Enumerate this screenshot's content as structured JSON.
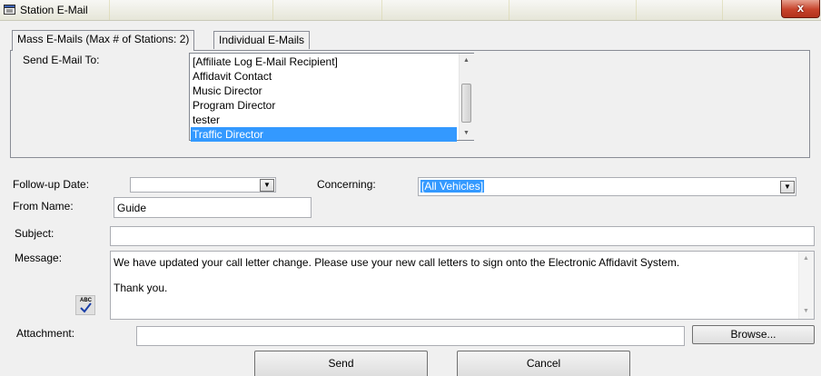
{
  "window": {
    "title": "Station E-Mail",
    "close_symbol": "x"
  },
  "tabs": [
    {
      "label": "Mass E-Mails (Max # of Stations: 2)",
      "selected": true
    },
    {
      "label": "Individual E-Mails",
      "selected": false
    }
  ],
  "send_to": {
    "label": "Send E-Mail To:",
    "items": [
      "[Affiliate Log E-Mail Recipient]",
      "Affidavit Contact",
      "Music Director",
      "Program Director",
      "tester",
      "Traffic Director"
    ],
    "selected_item": "Traffic Director"
  },
  "form": {
    "followup_label": "Follow-up Date:",
    "followup_value": "",
    "concerning_label": "Concerning:",
    "concerning_value": "[All Vehicles]",
    "from_label": "From Name:",
    "from_value": "Guide",
    "subject_label": "Subject:",
    "subject_value": "",
    "message_label": "Message:",
    "message_line1": "We have updated your call letter change. Please use your new call letters to sign onto the Electronic Affidavit System.",
    "message_line2": "Thank you.",
    "spellcheck_text": "ABC",
    "attachment_label": "Attachment:",
    "attachment_value": "",
    "browse_label": "Browse..."
  },
  "buttons": {
    "send": "Send",
    "cancel": "Cancel"
  },
  "colors": {
    "selection": "#3399ff",
    "close": "#c7432b"
  }
}
